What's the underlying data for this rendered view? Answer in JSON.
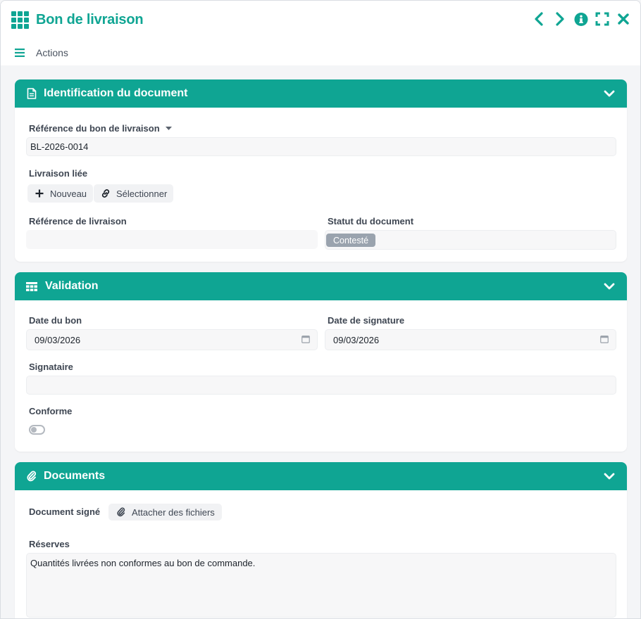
{
  "window": {
    "title": "Bon de livraison",
    "actions_label": "Actions"
  },
  "colors": {
    "accent": "#0fa593",
    "badge_grey": "#9aa3ae"
  },
  "icons": {
    "app": "grid-icon",
    "prev": "chevron-left-icon",
    "next": "chevron-right-icon",
    "info": "info-icon",
    "expand": "expand-icon",
    "close": "close-icon",
    "menu": "hamburger-icon"
  },
  "identification": {
    "title": "Identification du document",
    "ref_bon_label": "Référence du bon de livraison",
    "ref_bon_value": "BL-2026-0014",
    "livraison_liee_label": "Livraison liée",
    "btn_nouveau": "Nouveau",
    "btn_selectionner": "Sélectionner",
    "ref_livraison_label": "Référence de livraison",
    "ref_livraison_value": "",
    "statut_label": "Statut du document",
    "statut_value": "Contesté"
  },
  "validation": {
    "title": "Validation",
    "date_bon_label": "Date du bon",
    "date_bon_value": "09/03/2026",
    "date_signature_label": "Date de signature",
    "date_signature_value": "09/03/2026",
    "signataire_label": "Signataire",
    "signataire_value": "",
    "conforme_label": "Conforme",
    "conforme_on": false
  },
  "documents": {
    "title": "Documents",
    "doc_signe_label": "Document signé",
    "btn_attacher": "Attacher des fichiers",
    "reserves_label": "Réserves",
    "reserves_value": "Quantités livrées non conformes au bon de commande."
  }
}
